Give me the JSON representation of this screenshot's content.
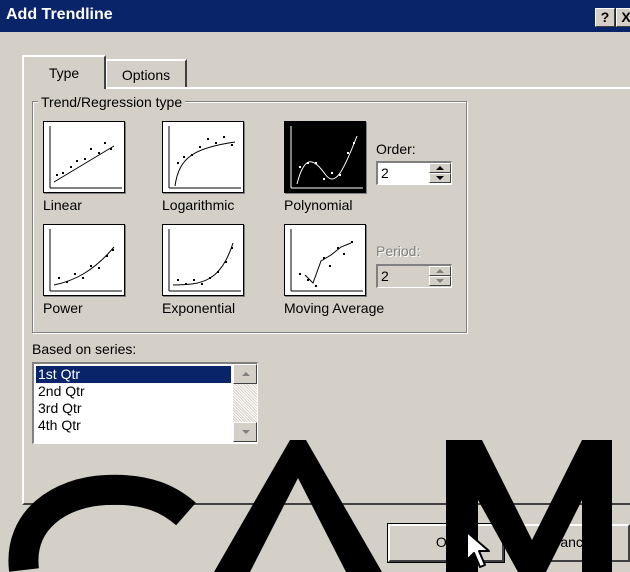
{
  "window": {
    "title": "Add Trendline",
    "help_glyph": "?",
    "close_glyph": "X"
  },
  "tabs": [
    {
      "label": "Type",
      "active": true
    },
    {
      "label": "Options",
      "active": false
    }
  ],
  "trend_group": {
    "label": "Trend/Regression type",
    "types": [
      {
        "label": "Linear",
        "selected": false
      },
      {
        "label": "Logarithmic",
        "selected": false
      },
      {
        "label": "Polynomial",
        "selected": true
      },
      {
        "label": "Power",
        "selected": false
      },
      {
        "label": "Exponential",
        "selected": false
      },
      {
        "label": "Moving Average",
        "selected": false
      }
    ],
    "order": {
      "label": "Order:",
      "value": "2",
      "enabled": true
    },
    "period": {
      "label": "Period:",
      "value": "2",
      "enabled": false
    }
  },
  "series": {
    "label": "Based on series:",
    "items": [
      "1st Qtr",
      "2nd Qtr",
      "3rd Qtr",
      "4th Qtr"
    ],
    "selected_index": 0
  },
  "buttons": {
    "ok": "OK",
    "cancel": "Cancel"
  },
  "watermark_text": "SAM",
  "colors": {
    "titlebar": "#0a246a",
    "face": "#d4d0c8",
    "selection": "#0a246a"
  }
}
